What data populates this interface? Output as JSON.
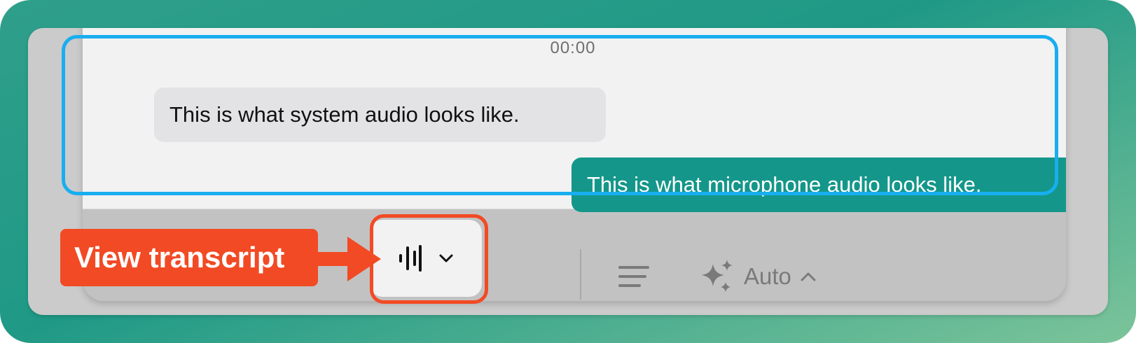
{
  "window": {
    "timer": "00:00"
  },
  "transcript": {
    "system_message": "This is what system audio looks like.",
    "microphone_message": "This is what microphone audio looks like."
  },
  "toolbar": {
    "auto_label": "Auto"
  },
  "annotation": {
    "callout_label": "View transcript"
  },
  "icons": {
    "transcript": "waveform-icon",
    "dropdown": "chevron-down-icon",
    "align": "align-left-icon",
    "ai": "sparkles-icon",
    "auto_expand": "chevron-up-icon"
  },
  "colors": {
    "microphone_bubble": "#14978a",
    "system_bubble": "#e3e3e6",
    "highlight_blue": "#18aef0",
    "highlight_red": "#f24a24",
    "callout": "#f24a24"
  }
}
